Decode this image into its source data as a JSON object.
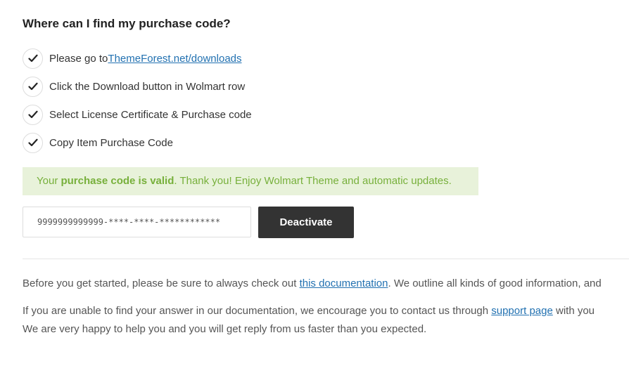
{
  "heading": "Where can I find my purchase code?",
  "steps": [
    {
      "text": "Please go to ",
      "link": "ThemeForest.net/downloads",
      "icon": "check-icon"
    },
    {
      "text": "Click the Download button in Wolmart row",
      "icon": "check-icon"
    },
    {
      "text": "Select License Certificate & Purchase code",
      "icon": "check-icon"
    },
    {
      "text": "Copy Item Purchase Code",
      "icon": "check-icon"
    }
  ],
  "notice": {
    "prefix": "Your ",
    "bold": "purchase code is valid",
    "suffix": ". Thank you! Enjoy Wolmart Theme and automatic updates.",
    "bg_color": "#e8f2da",
    "text_color": "#77b03b"
  },
  "license": {
    "code_value": "9999999999999-****-****-************",
    "button_label": "Deactivate"
  },
  "info": {
    "line1_before": "Before you get started, please be sure to always check out ",
    "line1_link": "this documentation",
    "line1_after": ". We outline all kinds of good information, and",
    "line2_before": "If you are unable to find your answer in our documentation, we encourage you to contact us through ",
    "line2_link": "support page",
    "line2_after": " with you",
    "line3": "We are very happy to help you and you will get reply from us faster than you expected."
  },
  "colors": {
    "link": "#2271b1",
    "button_bg": "#333333",
    "heading": "#222222"
  }
}
